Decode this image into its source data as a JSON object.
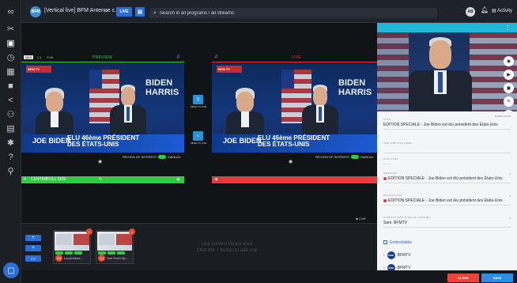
{
  "topbar": {
    "channel_avatar": "BFM",
    "channel_title": "[Vertical live] BFM Antenne c...",
    "live_label": "LIVE",
    "search_placeholder": "Search in all programs / all streams",
    "user_initials": "AB",
    "activity_label": "Activity"
  },
  "rail_icons": [
    "logo-icon",
    "scissors-icon",
    "layers-icon",
    "clock-icon",
    "grid-icon",
    "video-icon",
    "share-icon",
    "users-icon",
    "calendar-icon",
    "puzzle-icon",
    "help-icon",
    "pin-icon"
  ],
  "editor": {
    "aspect_options": [
      "16:9",
      "1:1",
      "9:16"
    ],
    "preview_title": "PREVIEW",
    "live_title": "LIVE",
    "preview_ctrl": {
      "center_label": "CENTER",
      "full_size_label": "FULL SIZE"
    },
    "roi_label": "REGION OF INTEREST",
    "roi_suffix": "MANUAL",
    "side_caption_1": "SEND TO LIVE",
    "side_caption_2": "SEND TO LIVE",
    "live_tag": "LIVE"
  },
  "video": {
    "bug": "BFM TV",
    "wall_left": "BIDEN HARRIS",
    "name": "JOE BIDEN",
    "headline_1": "ELU 46ème PRÉSIDENT",
    "headline_2": "DES ÉTATS-UNIS"
  },
  "library": {
    "message_1": "Live content library area",
    "message_2": "Click the + button to add one",
    "cards": [
      {
        "name": "Local News...",
        "logo": "LCI"
      },
      {
        "name": "Live From Sp...",
        "logo": "LCI"
      }
    ]
  },
  "panel": {
    "status": "12:0:00 • 01:06",
    "title_label": "TITLE",
    "title_value": "EDITION SPECIALE - Joe Biden est élu président des États-Unis",
    "subtitle_label": "ADD SUBTITLE HERE",
    "tags_label": "HASHTAGS",
    "message_label": "MESSAGE",
    "message_value": "EDITION SPECIALE - Joe Biden est élu président des États-Unis",
    "description_label": "DESCRIPTION",
    "description_value": "EDITION SPECIALE - Joe Biden est élu président des États-Unis",
    "publish_label": "PUBLICATION ON SOCIAL STORIES",
    "publish_value": "Sam. BFMTV",
    "embeddable_label": "Embeddable",
    "channels": [
      "BFMTV",
      "BFMTV"
    ],
    "close_label": "CLOSE",
    "save_label": "SAVE"
  },
  "colors": {
    "preview": "#2ecc40",
    "live": "#e83a3a",
    "accent": "#2b6fd6",
    "panel_header": "#20b8d8"
  }
}
